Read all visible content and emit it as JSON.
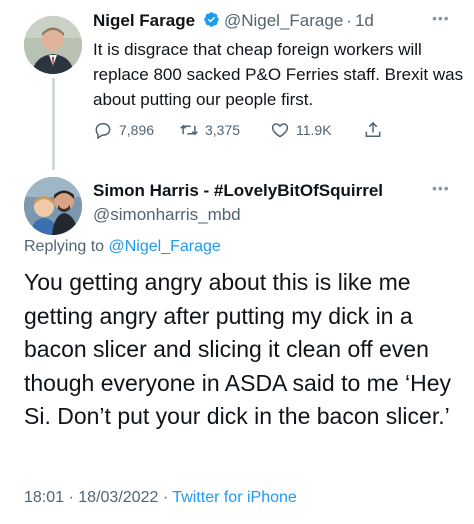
{
  "reply_to_tweet": {
    "author_name": "Nigel Farage",
    "handle": "@Nigel_Farage",
    "separator": "·",
    "time": "1d",
    "text": "It is disgrace that cheap foreign workers will replace 800 sacked P&O Ferries staff. Brexit was about putting our people first.",
    "verified_icon": "verified-badge-icon",
    "more_icon": "more-dots-icon",
    "actions": {
      "replies": "7,896",
      "retweets": "3,375",
      "likes": "11.9K"
    }
  },
  "tweet": {
    "author_name": "Simon Harris - #LovelyBitOfSquirrel",
    "handle": "@simonharris_mbd",
    "replying_prefix": "Replying to",
    "replying_to": "@Nigel_Farage",
    "text": "You getting angry about this is like me getting angry after putting my dick in a bacon slicer and slicing it clean off even though everyone in ASDA said to me ‘Hey Si. Don’t put your dick in the bacon slicer.’",
    "time": "18:01",
    "date": "18/03/2022",
    "separator": "·",
    "source": "Twitter for iPhone",
    "more_icon": "more-dots-icon"
  },
  "colors": {
    "text": "#0f1419",
    "secondary": "#536471",
    "accent": "#1d9bf0",
    "thread_line": "#cfd9de"
  }
}
